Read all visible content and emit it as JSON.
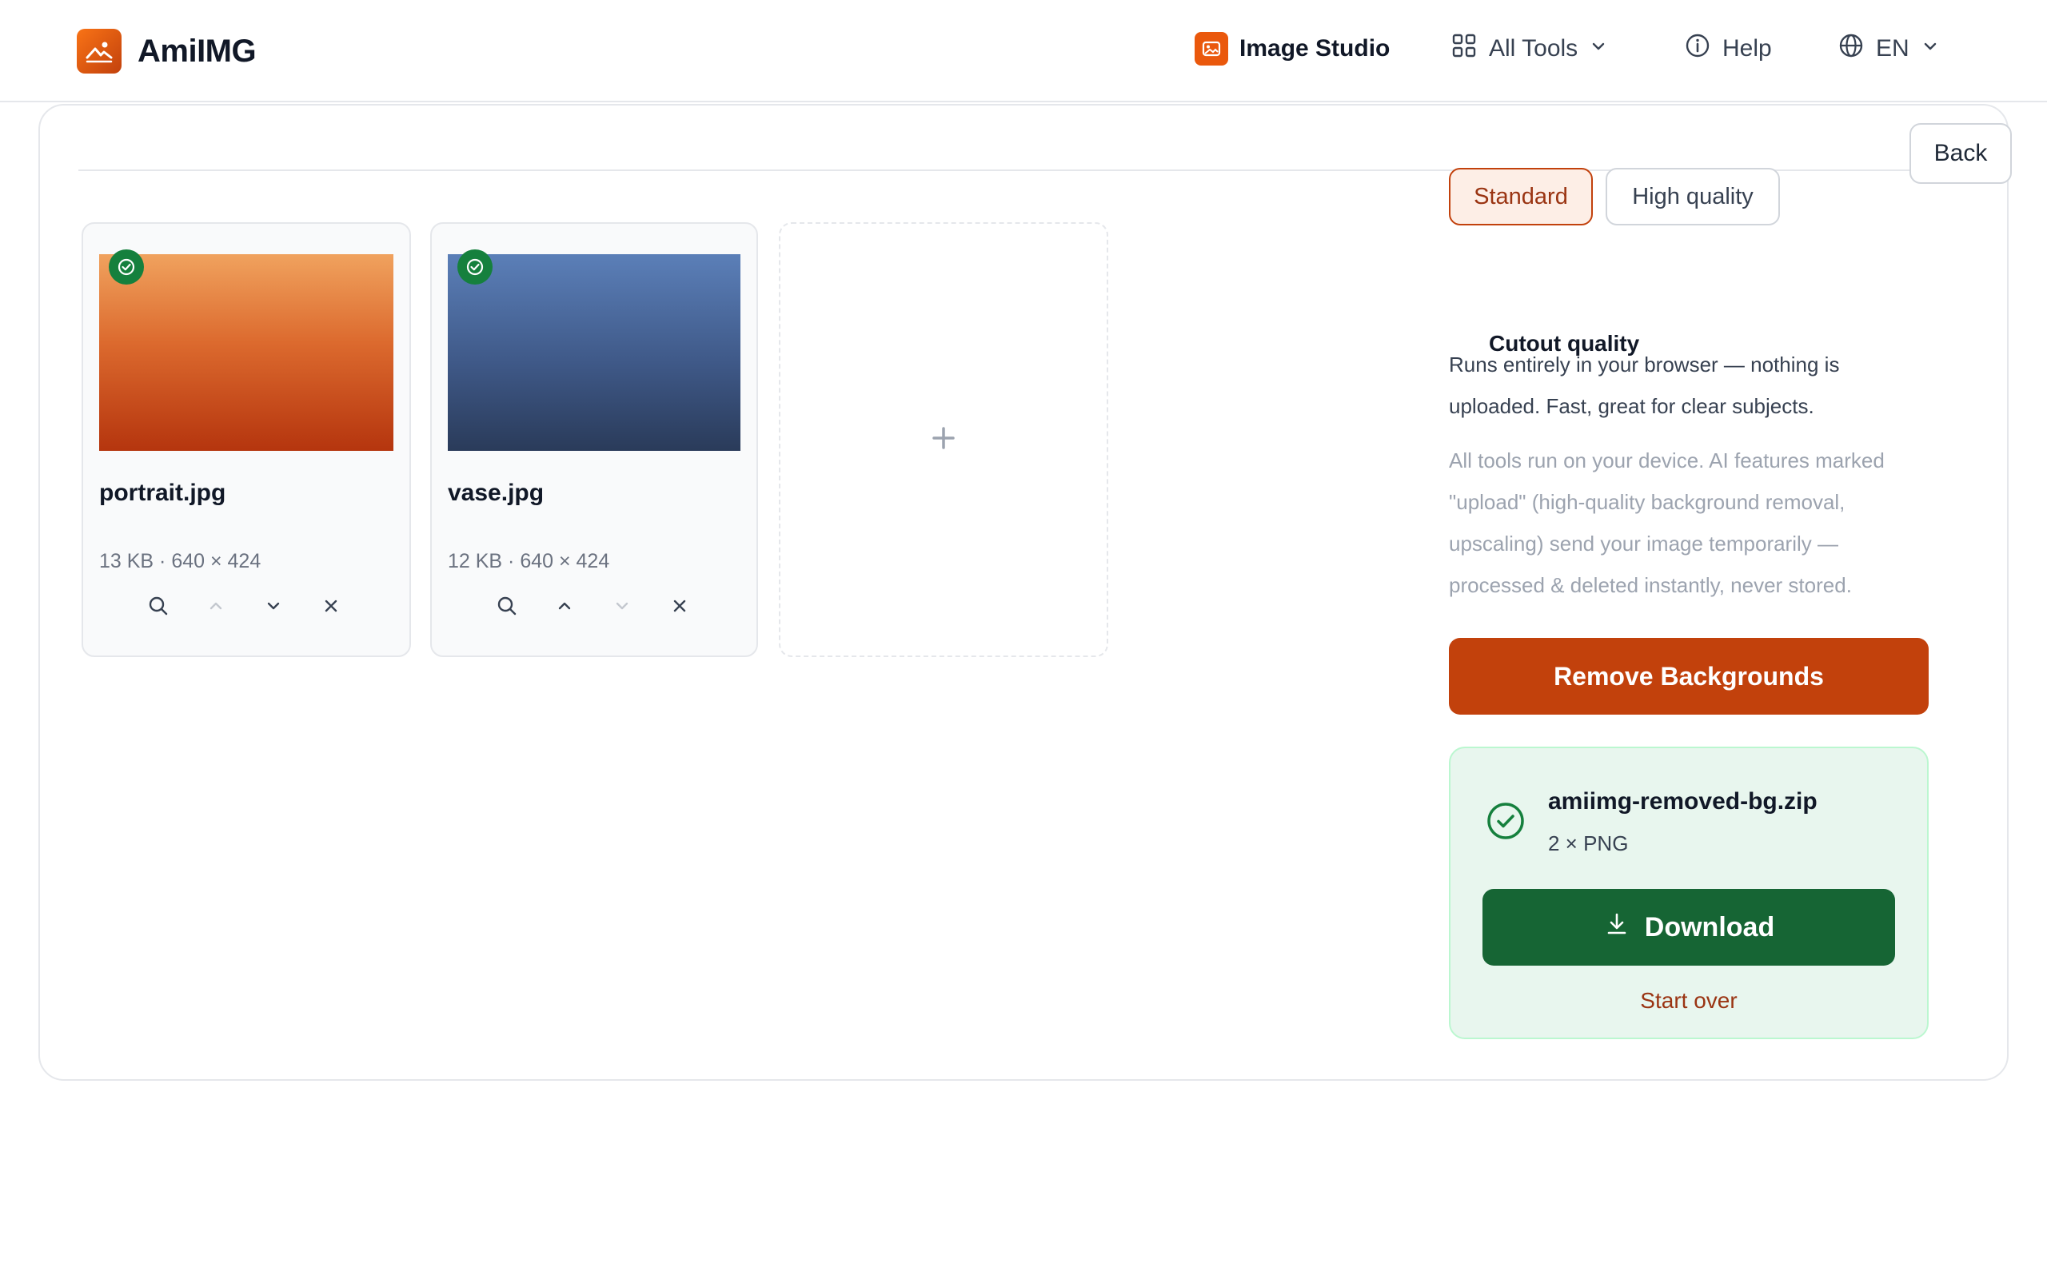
{
  "header": {
    "brand": "AmiIMG",
    "nav": {
      "studio": "Image Studio",
      "tools": "All Tools",
      "help": "Help",
      "language": "EN"
    }
  },
  "toolbar": {
    "back_label": "Back"
  },
  "files": [
    {
      "name": "portrait.jpg",
      "meta": "13 KB · 640 × 424"
    },
    {
      "name": "vase.jpg",
      "meta": "12 KB · 640 × 424"
    }
  ],
  "settings": {
    "quality_label": "Cutout quality",
    "options": [
      "Standard",
      "High quality"
    ],
    "selected": "Standard",
    "description": "Runs entirely in your browser — nothing is uploaded. Fast, great for clear subjects.",
    "privacy_note": "All tools run on your device. AI features marked \"upload\" (high-quality background removal, upscaling) send your image temporarily — processed & deleted instantly, never stored.",
    "action_label": "Remove Backgrounds"
  },
  "result": {
    "filename": "amiimg-removed-bg.zip",
    "meta": "2 × PNG",
    "download_label": "Download",
    "start_over_label": "Start over"
  },
  "colors": {
    "accent": "#c2410c",
    "success": "#166534"
  }
}
